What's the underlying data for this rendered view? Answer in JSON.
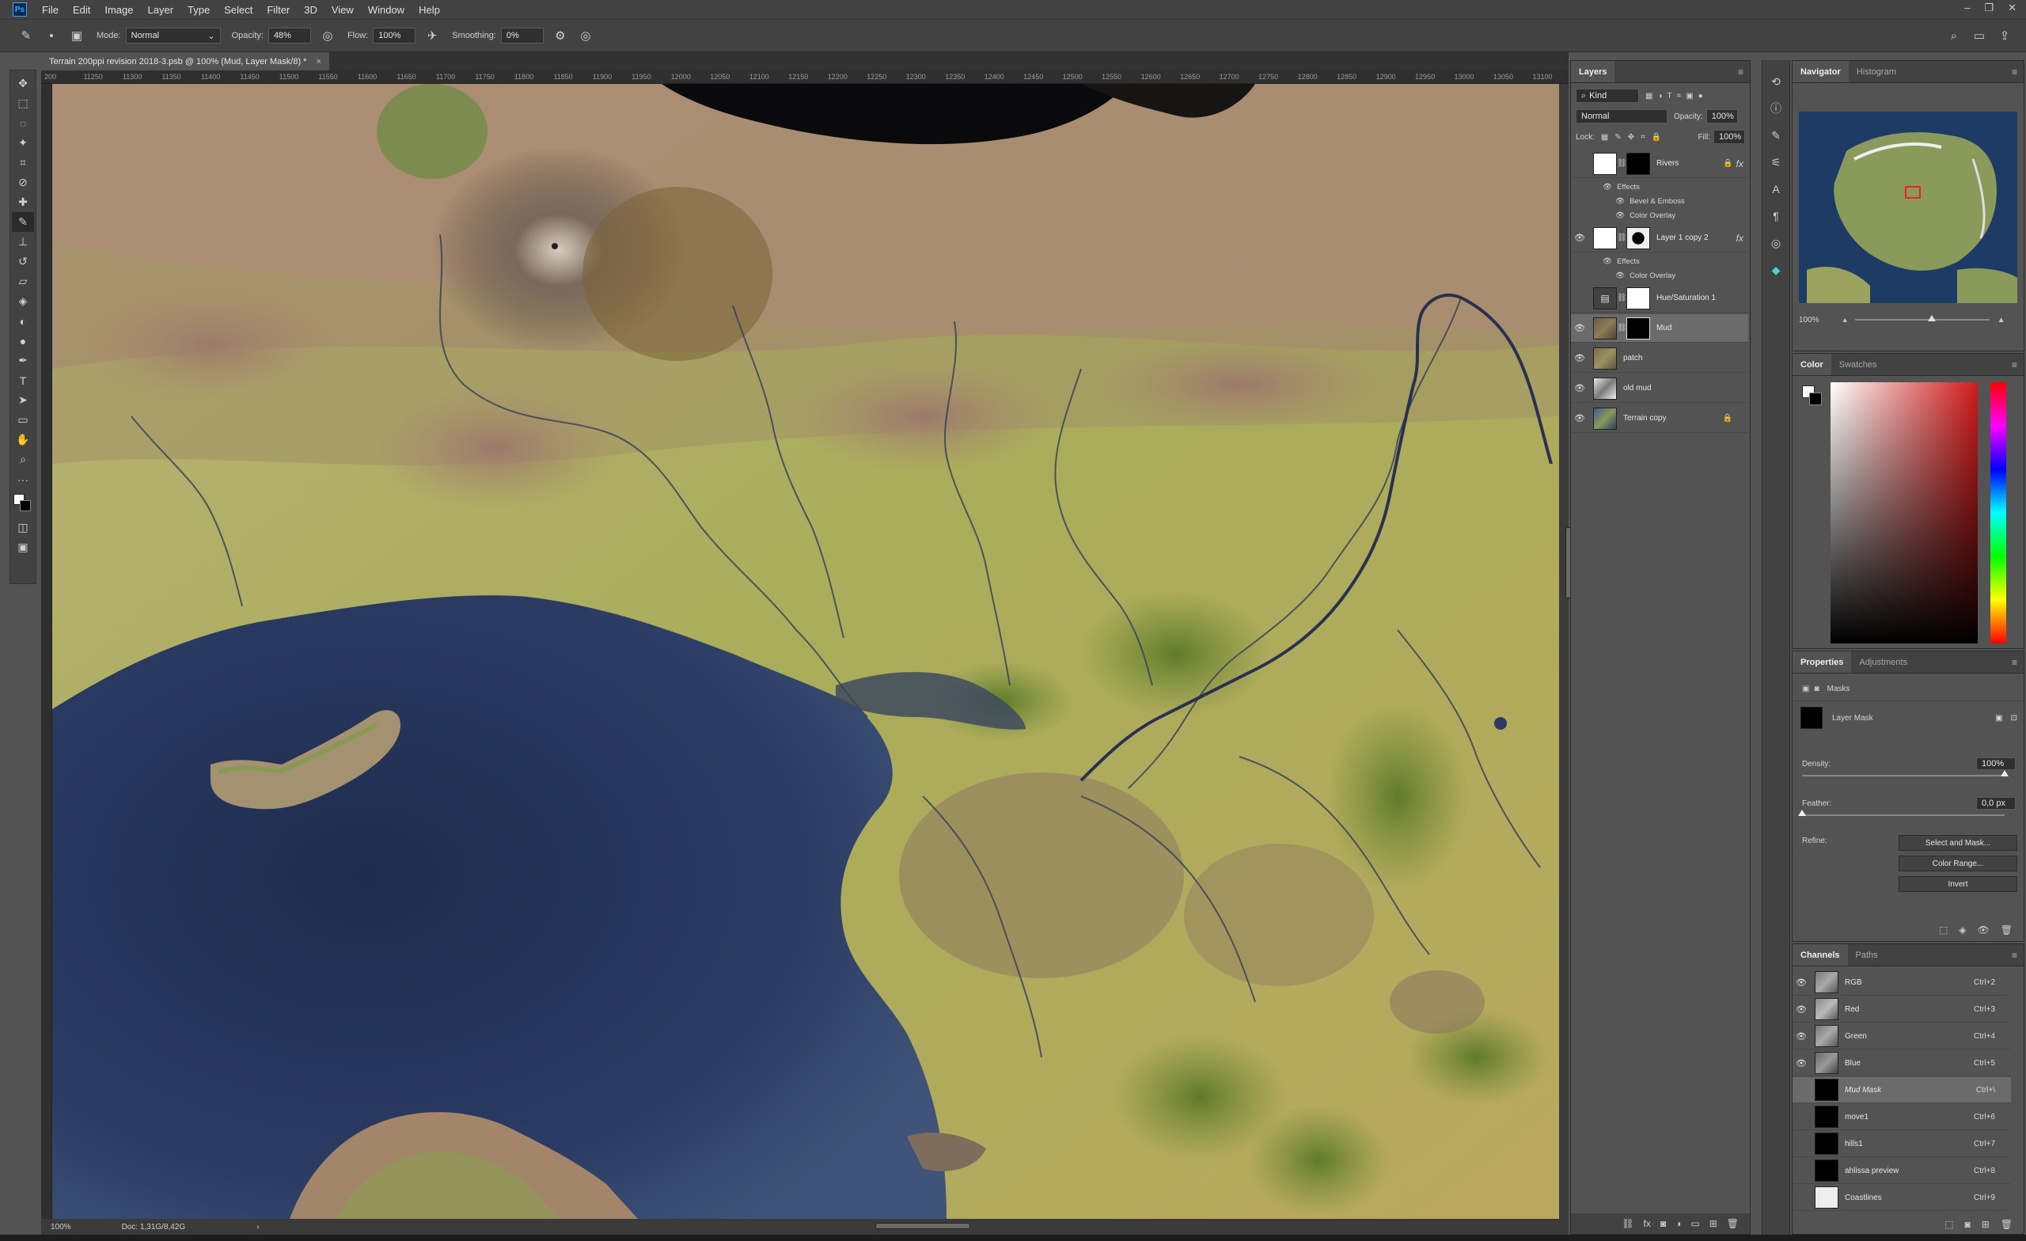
{
  "menubar": {
    "app_logo": "Ps",
    "items": [
      "File",
      "Edit",
      "Image",
      "Layer",
      "Type",
      "Select",
      "Filter",
      "3D",
      "View",
      "Window",
      "Help"
    ],
    "window_controls": [
      "–",
      "❐",
      "✕"
    ]
  },
  "options": {
    "mode_label": "Mode:",
    "mode_value": "Normal",
    "opacity_label": "Opacity:",
    "opacity_value": "48%",
    "flow_label": "Flow:",
    "flow_value": "100%",
    "smoothing_label": "Smoothing:",
    "smoothing_value": "0%"
  },
  "document": {
    "tab_title": "Terrain 200ppi revision 2018-3.psb @ 100% (Mud, Layer Mask/8) *",
    "close": "×",
    "ruler_ticks": [
      "200",
      "11250",
      "11300",
      "11350",
      "11400",
      "11450",
      "11500",
      "11550",
      "11600",
      "11650",
      "11700",
      "11750",
      "11800",
      "11850",
      "11900",
      "11950",
      "12000",
      "12050",
      "12100",
      "12150",
      "12200",
      "12250",
      "12300",
      "12350",
      "12400",
      "12450",
      "12500",
      "12550",
      "12600",
      "12650",
      "12700",
      "12750",
      "12800",
      "12850",
      "12900",
      "12950",
      "13000",
      "13050",
      "13100"
    ],
    "status_zoom": "100%",
    "status_doc": "Doc: 1,31G/8,42G",
    "status_arrow": "›"
  },
  "layers_panel": {
    "tab": "Layers",
    "kind_label": "Kind",
    "blend_mode": "Normal",
    "opacity_label": "Opacity:",
    "opacity_value": "100%",
    "lock_label": "Lock:",
    "fill_label": "Fill:",
    "fill_value": "100%",
    "layers": [
      {
        "name": "Rivers",
        "visible": false,
        "fx": true
      },
      {
        "name": "Layer 1 copy 2",
        "visible": true,
        "fx": true
      },
      {
        "name": "Hue/Saturation 1",
        "visible": false,
        "fx": false
      },
      {
        "name": "Mud",
        "visible": true,
        "fx": false,
        "selected": true
      },
      {
        "name": "patch",
        "visible": true,
        "fx": false
      },
      {
        "name": "old mud",
        "visible": true,
        "fx": false
      },
      {
        "name": "Terrain copy",
        "visible": true,
        "fx": false,
        "locked": true
      }
    ],
    "effects_label": "Effects",
    "effects_rivers": [
      "Bevel & Emboss",
      "Color Overlay"
    ],
    "effects_layer1copy2": [
      "Color Overlay"
    ]
  },
  "navigator": {
    "tabs": [
      "Navigator",
      "Histogram"
    ],
    "zoom": "100%"
  },
  "color_panel": {
    "tabs": [
      "Color",
      "Swatches"
    ],
    "accent": "#d11a1a"
  },
  "properties": {
    "tabs": [
      "Properties",
      "Adjustments"
    ],
    "masks_label": "Masks",
    "layer_mask_label": "Layer Mask",
    "density_label": "Density:",
    "density_value": "100%",
    "density_level": 1.0,
    "feather_label": "Feather:",
    "feather_value": "0,0 px",
    "feather_level": 0.0,
    "refine_label": "Refine:",
    "buttons": [
      "Select and Mask...",
      "Color Range...",
      "Invert"
    ]
  },
  "channels": {
    "tabs": [
      "Channels",
      "Paths"
    ],
    "rows": [
      {
        "name": "RGB",
        "key": "Ctrl+2",
        "visible": true
      },
      {
        "name": "Red",
        "key": "Ctrl+3",
        "visible": true
      },
      {
        "name": "Green",
        "key": "Ctrl+4",
        "visible": true
      },
      {
        "name": "Blue",
        "key": "Ctrl+5",
        "visible": true
      },
      {
        "name": "Mud Mask",
        "key": "Ctrl+\\",
        "visible": false,
        "selected": true
      },
      {
        "name": "move1",
        "key": "Ctrl+6",
        "visible": false
      },
      {
        "name": "hills1",
        "key": "Ctrl+7",
        "visible": false
      },
      {
        "name": "ahlissa preview",
        "key": "Ctrl+8",
        "visible": false
      },
      {
        "name": "Coastlines",
        "key": "Ctrl+9",
        "visible": false
      }
    ]
  }
}
